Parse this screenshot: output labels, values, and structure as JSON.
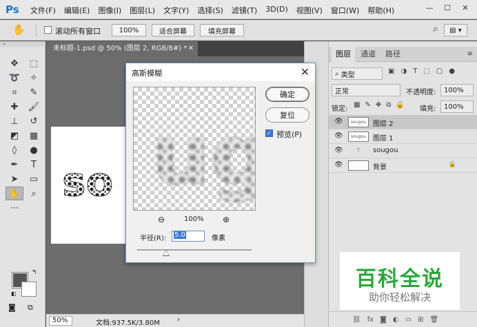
{
  "app": {
    "logo": "Ps"
  },
  "menu": [
    "文件(F)",
    "编辑(E)",
    "图像(I)",
    "图层(L)",
    "文字(Y)",
    "选择(S)",
    "滤镜(T)",
    "3D(D)",
    "视图(V)",
    "窗口(W)",
    "帮助(H)"
  ],
  "options": {
    "scroll_all_label": "滚动所有窗口",
    "zoom_100_label": "100%",
    "fit_screen_label": "适合屏幕",
    "fill_screen_label": "填充屏幕"
  },
  "document": {
    "tab_title": "未标题-1.psd @ 50% (图层 2, RGB/8#) *",
    "canvas_text": "so",
    "status_zoom": "50%",
    "status_info": "文档:937.5K/3.80M"
  },
  "dialog": {
    "title": "高斯模糊",
    "ok_label": "确定",
    "reset_label": "复位",
    "preview_label": "预览(P)",
    "preview_zoom": "100%",
    "preview_text": "ug",
    "radius_label": "半径(R):",
    "radius_value": "5.0",
    "radius_unit": "像素"
  },
  "layers_panel": {
    "tabs": [
      "图层",
      "通道",
      "路径"
    ],
    "filter_label": "类型",
    "blend_mode": "正常",
    "opacity_label": "不透明度:",
    "opacity_value": "100%",
    "lock_label": "锁定:",
    "fill_label": "填充:",
    "fill_value": "100%",
    "layers": [
      {
        "name": "图层 2",
        "thumb": "sougou"
      },
      {
        "name": "图层 1",
        "thumb": "sougou"
      },
      {
        "name": "sougou",
        "thumb": ""
      },
      {
        "name": "背景",
        "thumb": ""
      }
    ]
  },
  "watermark": {
    "title": "百科全说",
    "subtitle": "助你轻松解决"
  }
}
